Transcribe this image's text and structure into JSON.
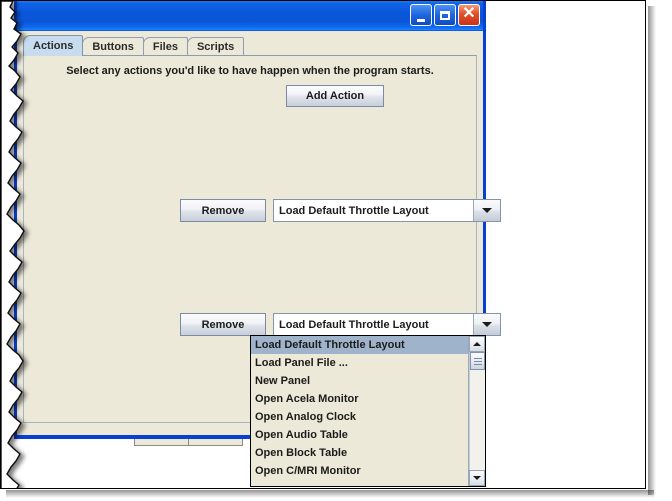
{
  "window": {
    "title": "",
    "buttons": [
      {
        "name": "minimize",
        "glyph": "minimize-icon"
      },
      {
        "name": "maximize",
        "glyph": "maximize-icon"
      },
      {
        "name": "close",
        "glyph": "✕"
      }
    ]
  },
  "tabs": [
    {
      "label": "Actions",
      "selected": true
    },
    {
      "label": "Buttons",
      "selected": false
    },
    {
      "label": "Files",
      "selected": false
    },
    {
      "label": "Scripts",
      "selected": false
    }
  ],
  "content": {
    "instruction": "Select any actions you'd like to have happen when the program starts.",
    "add_action_label": "Add Action"
  },
  "action_rows": [
    {
      "remove_label": "Remove",
      "combo_value": "Load Default Throttle Layout"
    },
    {
      "remove_label": "Remove",
      "combo_value": "Load Default Throttle Layout"
    }
  ],
  "dropdown": {
    "open": true,
    "selected_index": 0,
    "items": [
      "Load Default Throttle Layout",
      "Load Panel File ...",
      "New Panel",
      "Open Acela Monitor",
      "Open Analog Clock",
      "Open Audio Table",
      "Open Block Table",
      "Open C/MRI Monitor"
    ]
  },
  "colors": {
    "title_bar_blue": "#0956d8",
    "window_border_blue": "#0a3fd4",
    "panel_face": "#ece9d8",
    "selected_tab": "#c8dcf0",
    "list_highlight": "#9fb3cb",
    "close_button_red": "#e0502a"
  }
}
